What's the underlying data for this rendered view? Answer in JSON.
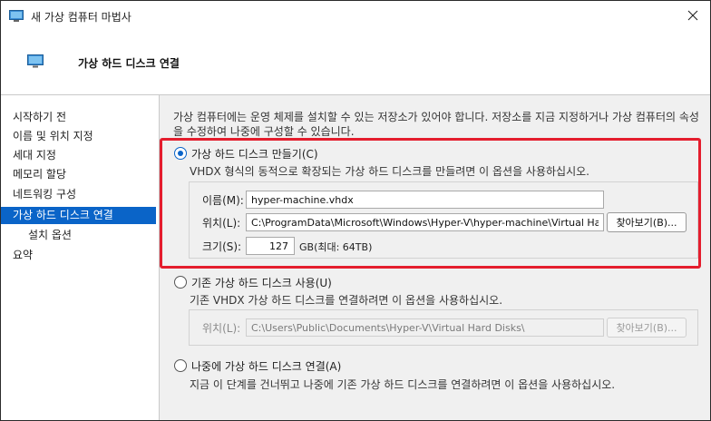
{
  "window": {
    "title": "새 가상 컴퓨터 마법사"
  },
  "header": {
    "title": "가상 하드 디스크 연결"
  },
  "sidebar": {
    "items": [
      {
        "label": "시작하기 전"
      },
      {
        "label": "이름 및 위치 지정"
      },
      {
        "label": "세대 지정"
      },
      {
        "label": "메모리 할당"
      },
      {
        "label": "네트워킹 구성"
      },
      {
        "label": "가상 하드 디스크 연결"
      },
      {
        "label": "설치 옵션"
      },
      {
        "label": "요약"
      }
    ],
    "active_index": 5
  },
  "main": {
    "description_line1": "가상 컴퓨터에는 운영 체제를 설치할 수 있는 저장소가 있어야 합니다. 저장소를 지금 지정하거나 가상 컴퓨터의 속성",
    "description_line2": "을 수정하여 나중에 구성할 수 있습니다.",
    "create_option": {
      "label": "가상 하드 디스크 만들기(C)",
      "description": "VHDX 형식의 동적으로 확장되는 가상 하드 디스크를 만들려면 이 옵션을 사용하십시오.",
      "checked": true,
      "name_label": "이름(M):",
      "name_value": "hyper-machine.vhdx",
      "location_label": "위치(L):",
      "location_value": "C:\\ProgramData\\Microsoft\\Windows\\Hyper-V\\hyper-machine\\Virtual Hard Disks\\",
      "browse_label": "찾아보기(B)...",
      "size_label": "크기(S):",
      "size_value": "127",
      "size_unit": "GB(최대: 64TB)"
    },
    "existing_option": {
      "label": "기존 가상 하드 디스크 사용(U)",
      "description": "기존 VHDX 가상 하드 디스크를 연결하려면 이 옵션을 사용하십시오.",
      "checked": false,
      "location_label": "위치(L):",
      "location_value": "C:\\Users\\Public\\Documents\\Hyper-V\\Virtual Hard Disks\\",
      "browse_label": "찾아보기(B)..."
    },
    "later_option": {
      "label": "나중에 가상 하드 디스크 연결(A)",
      "description": "지금 이 단계를 건너뛰고 나중에 기존 가상 하드 디스크를 연결하려면 이 옵션을 사용하십시오.",
      "checked": false
    }
  },
  "colors": {
    "accent": "#0a64c8",
    "highlight": "#e41d2d",
    "content_bg": "#f0f0f0"
  }
}
